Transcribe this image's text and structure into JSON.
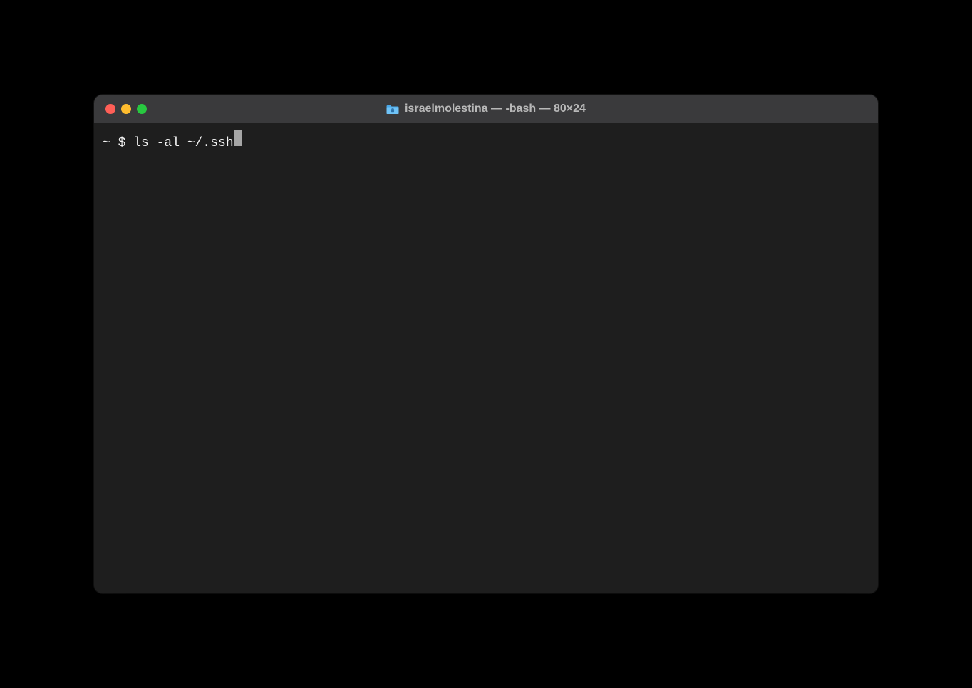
{
  "window": {
    "title": "israelmolestina — -bash — 80×24"
  },
  "terminal": {
    "prompt": "~ $ ",
    "command": "ls -al ~/.ssh"
  }
}
